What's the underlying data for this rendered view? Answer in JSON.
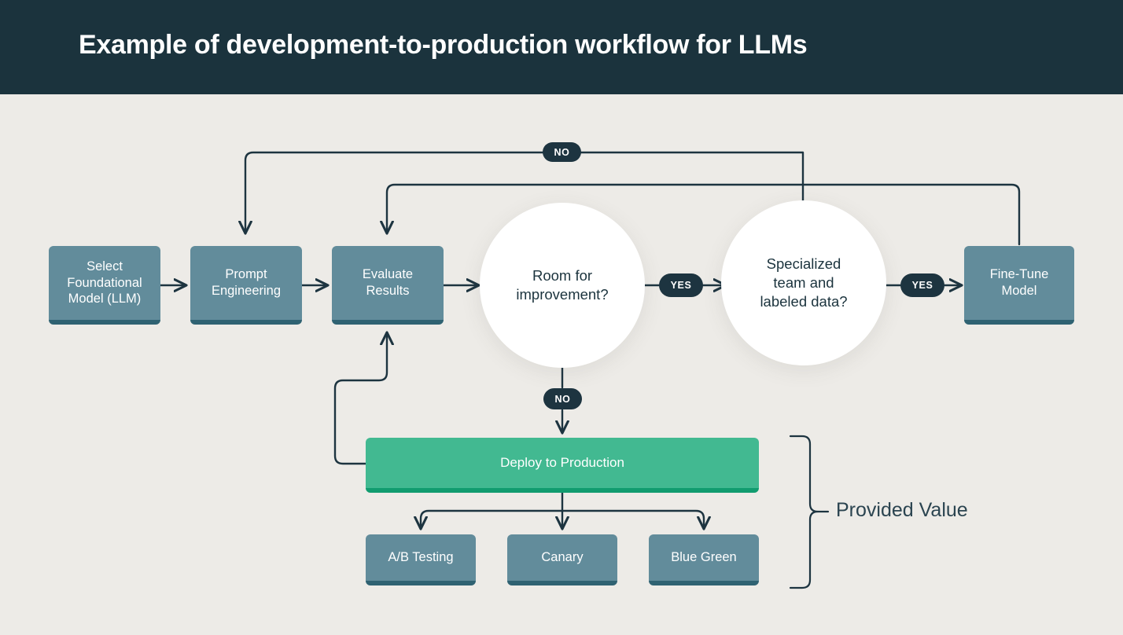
{
  "header": {
    "title": "Example of development-to-production workflow for LLMs",
    "bg_color": "#1b333d",
    "text_color": "#ffffff"
  },
  "canvas": {
    "background_color": "#edebe7",
    "line_color": "#1d3440"
  },
  "colors": {
    "process_box": "#628c9b",
    "process_box_shadow": "#2f6272",
    "deploy_box": "#42b991",
    "deploy_box_shadow": "#119c6f",
    "decision_circle": "#ffffff",
    "badge": "#1d3440",
    "badge_text": "#ffffff",
    "text_dark": "#1b333d"
  },
  "nodes": {
    "select_model": {
      "label": "Select\nFoundational\nModel (LLM)",
      "type": "process"
    },
    "prompt_engineering": {
      "label": "Prompt\nEngineering",
      "type": "process"
    },
    "evaluate_results": {
      "label": "Evaluate\nResults",
      "type": "process"
    },
    "room_for_improvement": {
      "label": "Room for\nimprovement?",
      "type": "decision"
    },
    "specialized_team": {
      "label": "Specialized\nteam and\nlabeled data?",
      "type": "decision"
    },
    "fine_tune_model": {
      "label": "Fine-Tune\nModel",
      "type": "process"
    },
    "deploy_to_production": {
      "label": "Deploy to Production",
      "type": "terminal"
    },
    "ab_testing": {
      "label": "A/B Testing",
      "type": "process"
    },
    "canary": {
      "label": "Canary",
      "type": "process"
    },
    "blue_green": {
      "label": "Blue Green",
      "type": "process"
    }
  },
  "badges": {
    "no_top": "NO",
    "yes_improvement": "YES",
    "yes_specialized": "YES",
    "no_deploy": "NO"
  },
  "annotations": {
    "provided_value": "Provided Value"
  },
  "chart_data": {
    "type": "diagram",
    "title": "Example of development-to-production workflow for LLMs",
    "diagram_kind": "flowchart",
    "nodes": [
      {
        "id": "select_model",
        "label": "Select Foundational Model (LLM)",
        "shape": "rect",
        "color": "#628c9b"
      },
      {
        "id": "prompt_engineering",
        "label": "Prompt Engineering",
        "shape": "rect",
        "color": "#628c9b"
      },
      {
        "id": "evaluate_results",
        "label": "Evaluate Results",
        "shape": "rect",
        "color": "#628c9b"
      },
      {
        "id": "room_for_improvement",
        "label": "Room for improvement?",
        "shape": "circle",
        "color": "#ffffff"
      },
      {
        "id": "specialized_team",
        "label": "Specialized team and labeled data?",
        "shape": "circle",
        "color": "#ffffff"
      },
      {
        "id": "fine_tune_model",
        "label": "Fine-Tune Model",
        "shape": "rect",
        "color": "#628c9b"
      },
      {
        "id": "deploy_to_production",
        "label": "Deploy to Production",
        "shape": "rect",
        "color": "#42b991"
      },
      {
        "id": "ab_testing",
        "label": "A/B Testing",
        "shape": "rect",
        "color": "#628c9b"
      },
      {
        "id": "canary",
        "label": "Canary",
        "shape": "rect",
        "color": "#628c9b"
      },
      {
        "id": "blue_green",
        "label": "Blue Green",
        "shape": "rect",
        "color": "#628c9b"
      }
    ],
    "edges": [
      {
        "from": "select_model",
        "to": "prompt_engineering",
        "label": ""
      },
      {
        "from": "prompt_engineering",
        "to": "evaluate_results",
        "label": ""
      },
      {
        "from": "evaluate_results",
        "to": "room_for_improvement",
        "label": ""
      },
      {
        "from": "room_for_improvement",
        "to": "specialized_team",
        "label": "YES"
      },
      {
        "from": "room_for_improvement",
        "to": "deploy_to_production",
        "label": "NO"
      },
      {
        "from": "specialized_team",
        "to": "fine_tune_model",
        "label": "YES"
      },
      {
        "from": "specialized_team",
        "to": "prompt_engineering",
        "label": "NO"
      },
      {
        "from": "fine_tune_model",
        "to": "evaluate_results",
        "label": ""
      },
      {
        "from": "deploy_to_production",
        "to": "evaluate_results",
        "label": ""
      },
      {
        "from": "deploy_to_production",
        "to": "ab_testing",
        "label": ""
      },
      {
        "from": "deploy_to_production",
        "to": "canary",
        "label": ""
      },
      {
        "from": "deploy_to_production",
        "to": "blue_green",
        "label": ""
      }
    ],
    "groups": [
      {
        "label": "Provided Value",
        "members": [
          "deploy_to_production",
          "ab_testing",
          "canary",
          "blue_green"
        ]
      }
    ]
  }
}
